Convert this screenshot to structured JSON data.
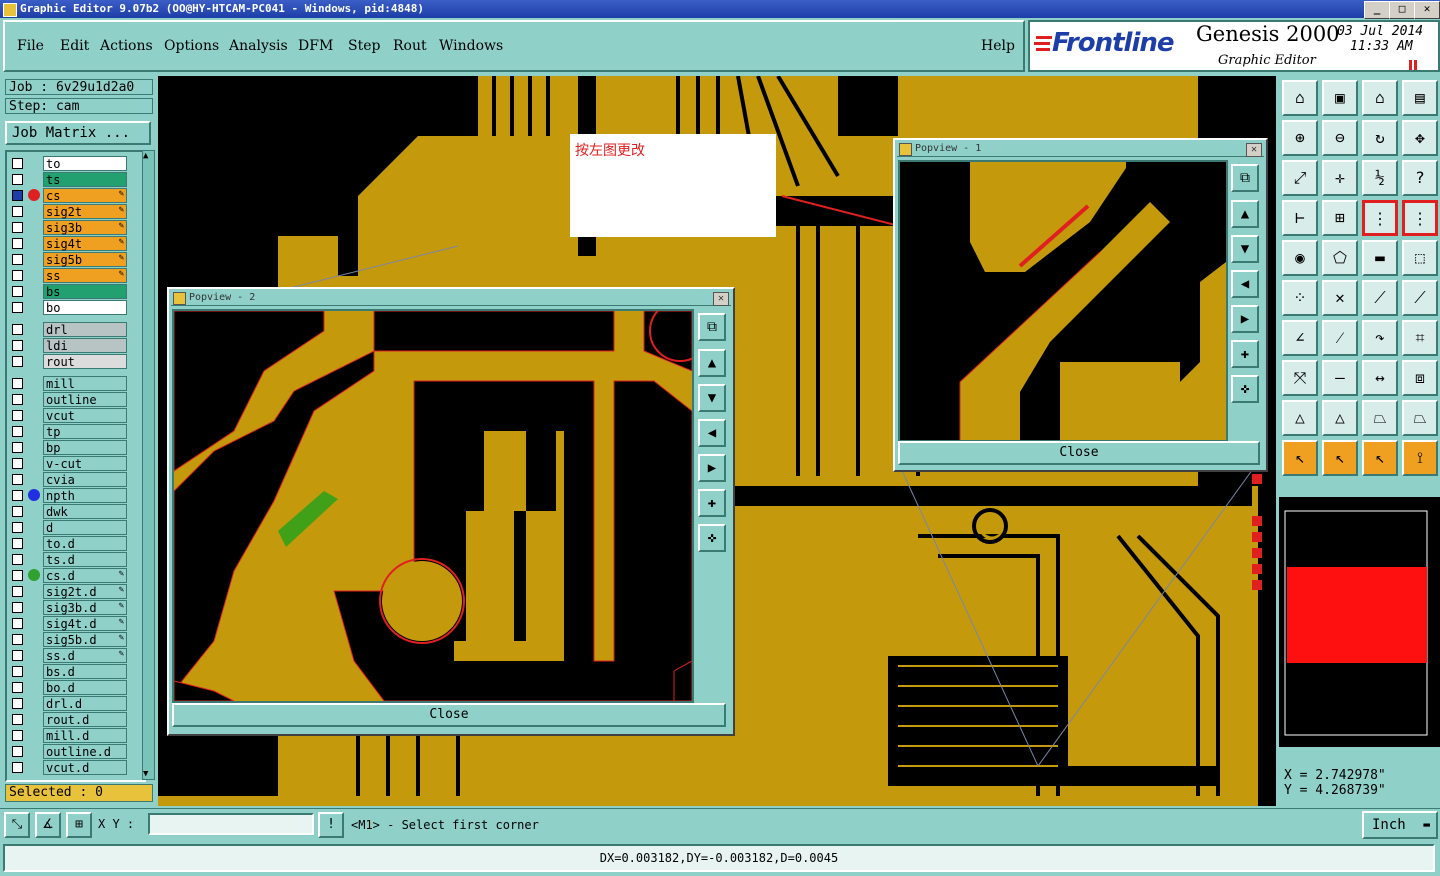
{
  "window": {
    "title": "Graphic Editor 9.07b2 (OO@HY-HTCAM-PC041 - Windows, pid:4848)"
  },
  "menu": {
    "items": [
      "File",
      "Edit",
      "Actions",
      "Options",
      "Analysis",
      "DFM",
      "Step",
      "Rout",
      "Windows"
    ],
    "help": "Help"
  },
  "logo": {
    "brand": "Frontline",
    "product": "Genesis 2000",
    "subtitle": "Graphic Editor",
    "date": "03 Jul 2014",
    "time": "11:33 AM"
  },
  "job": {
    "job_label": "Job : 6v29u1d2a0",
    "step_label": "Step: cam",
    "matrix_button": "Job Matrix ..."
  },
  "layers": [
    {
      "name": "to",
      "bg": "#ffffff",
      "dot": "",
      "edit": ""
    },
    {
      "name": "ts",
      "bg": "#22a070",
      "dot": "",
      "edit": ""
    },
    {
      "name": "cs",
      "bg": "#f0a020",
      "dot": "#e02020",
      "edit": "✎",
      "checked": true
    },
    {
      "name": "sig2t",
      "bg": "#f0a020",
      "dot": "",
      "edit": "✎"
    },
    {
      "name": "sig3b",
      "bg": "#f0a020",
      "dot": "",
      "edit": "✎"
    },
    {
      "name": "sig4t",
      "bg": "#f0a020",
      "dot": "",
      "edit": "✎"
    },
    {
      "name": "sig5b",
      "bg": "#f0a020",
      "dot": "",
      "edit": "✎"
    },
    {
      "name": "ss",
      "bg": "#f0a020",
      "dot": "",
      "edit": "✎"
    },
    {
      "name": "bs",
      "bg": "#22a070",
      "dot": "",
      "edit": ""
    },
    {
      "name": "bo",
      "bg": "#ffffff",
      "dot": "",
      "edit": ""
    },
    {
      "name": "drl",
      "bg": "#b8c4c4",
      "dot": "",
      "edit": "",
      "gap": true
    },
    {
      "name": "ldi",
      "bg": "#b8c4c4",
      "dot": "",
      "edit": ""
    },
    {
      "name": "rout",
      "bg": "#dcdcdc",
      "dot": "",
      "edit": ""
    },
    {
      "name": "mill",
      "bg": "#8fd1c9",
      "dot": "",
      "edit": "",
      "gap": true
    },
    {
      "name": "outline",
      "bg": "#8fd1c9",
      "dot": "",
      "edit": ""
    },
    {
      "name": "vcut",
      "bg": "#8fd1c9",
      "dot": "",
      "edit": ""
    },
    {
      "name": "tp",
      "bg": "#8fd1c9",
      "dot": "",
      "edit": ""
    },
    {
      "name": "bp",
      "bg": "#8fd1c9",
      "dot": "",
      "edit": ""
    },
    {
      "name": "v-cut",
      "bg": "#8fd1c9",
      "dot": "",
      "edit": ""
    },
    {
      "name": "cvia",
      "bg": "#8fd1c9",
      "dot": "",
      "edit": ""
    },
    {
      "name": "npth",
      "bg": "#8fd1c9",
      "dot": "#2030e0",
      "edit": ""
    },
    {
      "name": "dwk",
      "bg": "#8fd1c9",
      "dot": "",
      "edit": ""
    },
    {
      "name": "d",
      "bg": "#8fd1c9",
      "dot": "",
      "edit": ""
    },
    {
      "name": "to.d",
      "bg": "#8fd1c9",
      "dot": "",
      "edit": ""
    },
    {
      "name": "ts.d",
      "bg": "#8fd1c9",
      "dot": "",
      "edit": ""
    },
    {
      "name": "cs.d",
      "bg": "#8fd1c9",
      "dot": "#30a030",
      "edit": "✎"
    },
    {
      "name": "sig2t.d",
      "bg": "#8fd1c9",
      "dot": "",
      "edit": "✎"
    },
    {
      "name": "sig3b.d",
      "bg": "#8fd1c9",
      "dot": "",
      "edit": "✎"
    },
    {
      "name": "sig4t.d",
      "bg": "#8fd1c9",
      "dot": "",
      "edit": "✎"
    },
    {
      "name": "sig5b.d",
      "bg": "#8fd1c9",
      "dot": "",
      "edit": "✎"
    },
    {
      "name": "ss.d",
      "bg": "#8fd1c9",
      "dot": "",
      "edit": "✎"
    },
    {
      "name": "bs.d",
      "bg": "#8fd1c9",
      "dot": "",
      "edit": ""
    },
    {
      "name": "bo.d",
      "bg": "#8fd1c9",
      "dot": "",
      "edit": ""
    },
    {
      "name": "drl.d",
      "bg": "#8fd1c9",
      "dot": "",
      "edit": ""
    },
    {
      "name": "rout.d",
      "bg": "#8fd1c9",
      "dot": "",
      "edit": ""
    },
    {
      "name": "mill.d",
      "bg": "#8fd1c9",
      "dot": "",
      "edit": ""
    },
    {
      "name": "outline.d",
      "bg": "#8fd1c9",
      "dot": "",
      "edit": ""
    },
    {
      "name": "vcut.d",
      "bg": "#8fd1c9",
      "dot": "",
      "edit": ""
    }
  ],
  "selected_label": "Selected : 0",
  "popview1": {
    "title": "Popview - 1",
    "close": "Close"
  },
  "popview2": {
    "title": "Popview - 2",
    "close": "Close"
  },
  "annotation": {
    "text": "按左图更改"
  },
  "coords": {
    "x": "X = 2.742978\"",
    "y": "Y = 4.268739\""
  },
  "command": {
    "xy_label": "X Y :",
    "xy_value": "",
    "prompt": "<M1> - Select first corner",
    "units": "Inch"
  },
  "status": {
    "text": "DX=0.003182,DY=-0.003182,D=0.0045"
  },
  "colors": {
    "copper": "#c49a0c",
    "accent_red": "#e02020",
    "panel": "#8fd1c9"
  }
}
